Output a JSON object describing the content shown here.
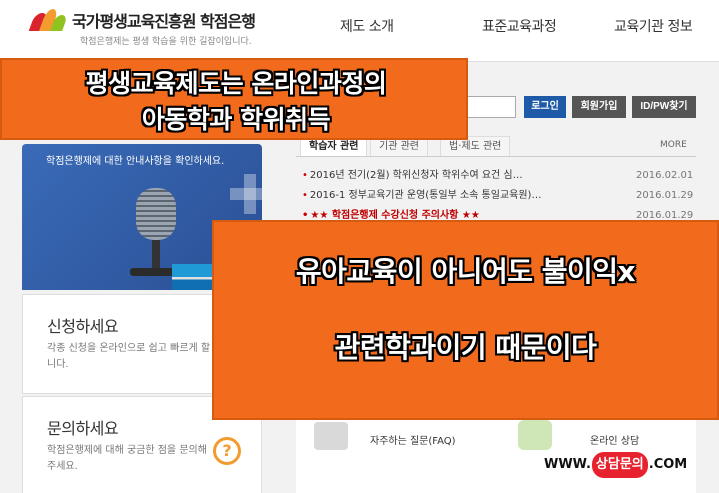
{
  "header": {
    "logo_text": "국가평생교육진흥원 학점은행",
    "logo_sub": "학점은행제는 평생 학습을 위한 길잡이입니다.",
    "nav": [
      "제도 소개",
      "표준교육과정",
      "교육기관 정보"
    ]
  },
  "hero": {
    "text": "학점은행제에 대한 안내사항을 확인하세요."
  },
  "cards": [
    {
      "title": "신청하세요",
      "desc": "각종 신청을 온라인으로 쉽고 빠르게 할 수 있습니다."
    },
    {
      "title": "문의하세요",
      "desc": "학점은행제에 대해 궁금한 점을 문의해주세요."
    }
  ],
  "login": {
    "login_label": "로그인",
    "join_label": "회원가입",
    "find_label": "ID/PW찾기"
  },
  "news": {
    "tabs": [
      "학습자 관련",
      "기관 관련",
      "법·제도 관련"
    ],
    "more_label": "MORE",
    "items": [
      {
        "title": "2016년 전기(2월) 학위신청자 학위수여 요건 심…",
        "date": "2016.02.01",
        "highlight": false
      },
      {
        "title": "2016-1 정부교육기관 운영(통일부 소속 통일교육원)…",
        "date": "2016.01.29",
        "highlight": false
      },
      {
        "title": "★★ 학점은행제 수강신청 주의사항 ★★",
        "date": "2016.01.29",
        "highlight": true
      }
    ]
  },
  "services": {
    "faq_label": "자주하는 질문(FAQ)",
    "counsel_label": "온라인 상담"
  },
  "overlay": {
    "banner1_line1": "평생교육제도는 온라인과정의",
    "banner1_line2": "아동학과 학위취득",
    "banner2_line1": "유아교육이 아니어도 불이익x",
    "banner2_line2": "관련학과이기 때문이다"
  },
  "watermark": {
    "prefix": "WWW.",
    "pill": "상담문의",
    "suffix": ".COM"
  },
  "colors": {
    "accent_orange": "#f26b1d",
    "login_blue": "#1e5aa8",
    "news_red": "#c00000"
  }
}
